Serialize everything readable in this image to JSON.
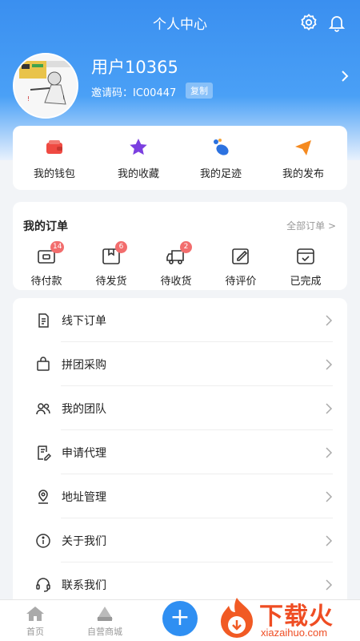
{
  "header": {
    "title": "个人中心"
  },
  "profile": {
    "username": "用户10365",
    "invite": "邀请码：IC00447",
    "copy_label": "复制"
  },
  "quick": [
    {
      "label": "我的钱包"
    },
    {
      "label": "我的收藏"
    },
    {
      "label": "我的足迹"
    },
    {
      "label": "我的发布"
    }
  ],
  "orders": {
    "title": "我的订单",
    "all_label": "全部订单 >",
    "items": [
      {
        "label": "待付款",
        "badge": "14"
      },
      {
        "label": "待发货",
        "badge": "6"
      },
      {
        "label": "待收货",
        "badge": "2"
      },
      {
        "label": "待评价",
        "badge": ""
      },
      {
        "label": "已完成",
        "badge": ""
      }
    ]
  },
  "menu": [
    {
      "label": "线下订单",
      "icon": "document-icon"
    },
    {
      "label": "拼团采购",
      "icon": "bag-icon"
    },
    {
      "label": "我的团队",
      "icon": "team-icon"
    },
    {
      "label": "申请代理",
      "icon": "edit-document-icon"
    },
    {
      "label": "地址管理",
      "icon": "location-icon"
    },
    {
      "label": "关于我们",
      "icon": "info-icon"
    },
    {
      "label": "联系我们",
      "icon": "headset-icon"
    }
  ],
  "tabbar": {
    "home": "首页",
    "mall": "自营商城",
    "add": "+"
  },
  "watermark": {
    "text": "下载火",
    "domain": "xiazaihuo.com"
  },
  "colors": {
    "primary": "#3a8ff0",
    "badge": "#f26d6d",
    "brand_watermark": "#ef4d23"
  }
}
